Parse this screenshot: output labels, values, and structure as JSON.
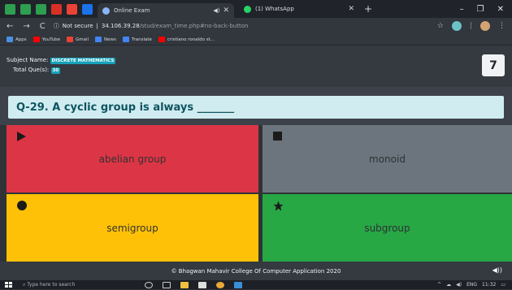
{
  "browser": {
    "tabs": [
      {
        "title": "Online Exam",
        "active": true
      },
      {
        "title": "(1) WhatsApp",
        "active": false
      }
    ],
    "url_secure_label": "Not secure",
    "url_host": "34.106.39.28",
    "url_path": "/stud/exam_time.php#no-back-button",
    "bookmarks": [
      "Apps",
      "YouTube",
      "Gmail",
      "News",
      "Translate",
      "cristiano ronaldo st..."
    ]
  },
  "header": {
    "subject_label": "Subject Name:",
    "subject_value": "DISCRETE MATHEMATICS",
    "total_label": "Total Que(s):",
    "total_value": "30",
    "timer": "7"
  },
  "question": {
    "text": "Q-29. A cyclic group is always _______"
  },
  "answers": [
    {
      "label": "abelian group",
      "symbol": "triangle",
      "color": "#dc3545"
    },
    {
      "label": "monoid",
      "symbol": "square",
      "color": "#6c757d"
    },
    {
      "label": "semigroup",
      "symbol": "circle",
      "color": "#ffc107"
    },
    {
      "label": "subgroup",
      "symbol": "star",
      "color": "#28a745"
    }
  ],
  "footer": {
    "text": "© Bhagwan Mahavir College Of Computer Application 2020"
  },
  "taskbar": {
    "search_placeholder": "Type here to search",
    "lang": "ENG",
    "time": "11:32"
  }
}
